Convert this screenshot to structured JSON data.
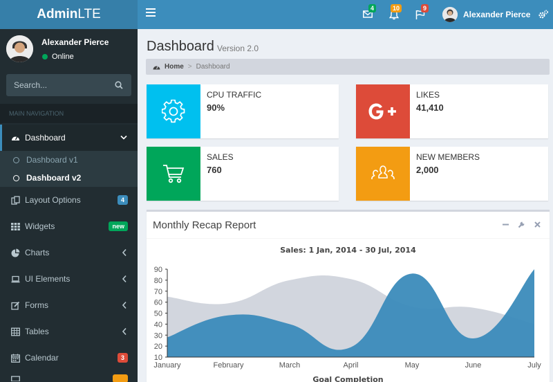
{
  "header": {
    "logo_bold": "Admin",
    "logo_light": "LTE",
    "messages_count": "4",
    "notifications_count": "10",
    "tasks_count": "9",
    "user_name": "Alexander Pierce",
    "badge_colors": {
      "messages": "#00a65a",
      "notifications": "#f39c12",
      "tasks": "#dd4b39"
    }
  },
  "sidebar": {
    "user_name": "Alexander Pierce",
    "status": "Online",
    "search_placeholder": "Search...",
    "section_label": "MAIN NAVIGATION",
    "items": [
      {
        "label": "Dashboard",
        "icon": "dashboard-icon",
        "active": true
      },
      {
        "label": "Layout Options",
        "icon": "files-icon",
        "badge": "4",
        "badge_color": "#3c8dbc"
      },
      {
        "label": "Widgets",
        "icon": "th-icon",
        "badge": "new",
        "badge_color": "#00a65a"
      },
      {
        "label": "Charts",
        "icon": "pie-chart-icon"
      },
      {
        "label": "UI Elements",
        "icon": "laptop-icon"
      },
      {
        "label": "Forms",
        "icon": "edit-icon"
      },
      {
        "label": "Tables",
        "icon": "table-icon"
      },
      {
        "label": "Calendar",
        "icon": "calendar-icon",
        "badge": "3",
        "badge_color": "#dd4b39"
      }
    ],
    "submenu": [
      {
        "label": "Dashboard v1"
      },
      {
        "label": "Dashboard v2",
        "active": true
      }
    ]
  },
  "content": {
    "title": "Dashboard",
    "subtitle": "Version 2.0",
    "breadcrumb": {
      "home": "Home",
      "separator": ">",
      "current": "Dashboard"
    },
    "info_boxes": [
      {
        "label": "CPU TRAFFIC",
        "value": "90%",
        "icon": "gear-icon",
        "color": "#00c0ef"
      },
      {
        "label": "LIKES",
        "value": "41,410",
        "icon": "google-plus-icon",
        "color": "#dd4b39"
      },
      {
        "label": "SALES",
        "value": "760",
        "icon": "shopping-cart-icon",
        "color": "#00a65a"
      },
      {
        "label": "NEW MEMBERS",
        "value": "2,000",
        "icon": "users-icon",
        "color": "#f39c12"
      }
    ],
    "report": {
      "title": "Monthly Recap Report",
      "chart_title": "Sales: 1 Jan, 2014 - 30 Jul, 2014",
      "footer_label": "Goal Completion"
    }
  },
  "chart_data": {
    "type": "area",
    "title": "Sales: 1 Jan, 2014 - 30 Jul, 2014",
    "categories": [
      "January",
      "February",
      "March",
      "April",
      "May",
      "June",
      "July"
    ],
    "series": [
      {
        "values": [
          65,
          59,
          80,
          81,
          56,
          55,
          40
        ],
        "color": "#d2d6de"
      },
      {
        "values": [
          28,
          48,
          40,
          19,
          86,
          27,
          90
        ],
        "color": "#3b8bba"
      }
    ],
    "ylim": [
      10,
      90
    ],
    "yticks": [
      10,
      20,
      30,
      40,
      50,
      60,
      70,
      80,
      90
    ],
    "grid": false
  }
}
